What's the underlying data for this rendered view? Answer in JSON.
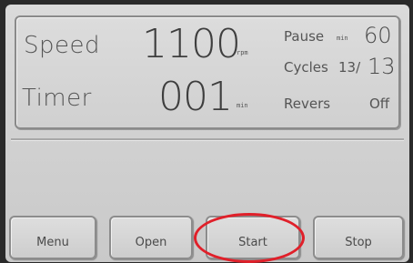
{
  "display": {
    "speed": {
      "label": "Speed",
      "value": "1100",
      "unit": "rpm"
    },
    "timer": {
      "label": "Timer",
      "value": "001",
      "unit": "min"
    },
    "pause": {
      "label": "Pause",
      "unit": "min",
      "value": "60"
    },
    "cycles": {
      "label": "Cycles",
      "current": "13/",
      "total": "13"
    },
    "reverse": {
      "label": "Revers",
      "value": "Off"
    }
  },
  "buttons": {
    "menu": "Menu",
    "open": "Open",
    "start": "Start",
    "stop": "Stop"
  },
  "annotation": {
    "color": "#e0202a",
    "target": "start-button"
  }
}
